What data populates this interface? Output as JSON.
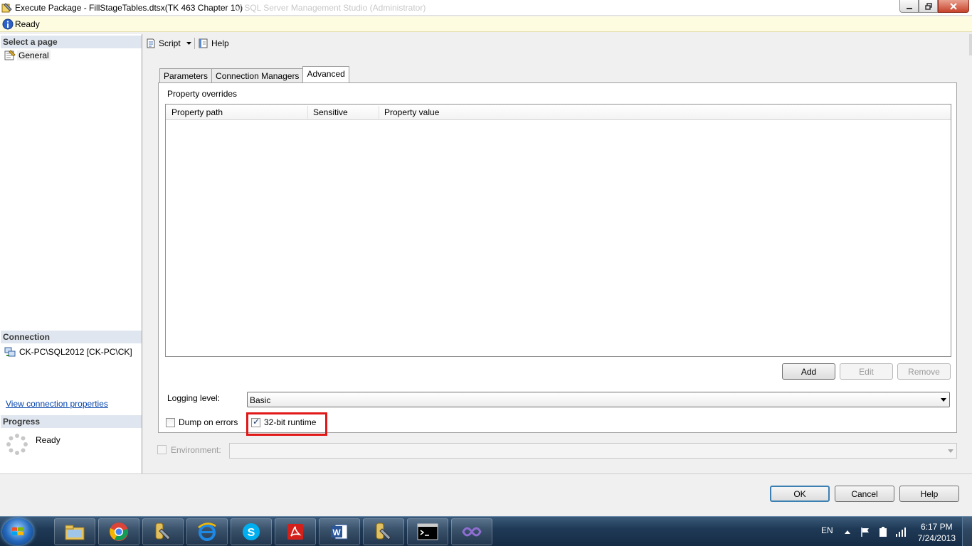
{
  "window": {
    "title": "Execute Package - FillStageTables.dtsx(TK 463 Chapter 10)",
    "title_ghost": "of SQL Server Management Studio (Administrator)"
  },
  "status": {
    "text": "Ready"
  },
  "left": {
    "select_page_header": "Select a page",
    "pages": [
      {
        "label": "General"
      }
    ],
    "connection_header": "Connection",
    "connection_label": "CK-PC\\SQL2012 [CK-PC\\CK]",
    "connection_link": "View connection properties",
    "progress_header": "Progress",
    "progress_text": "Ready"
  },
  "toolbar": {
    "script_label": "Script",
    "help_label": "Help"
  },
  "tabs": [
    {
      "label": "Parameters",
      "active": false
    },
    {
      "label": "Connection Managers",
      "active": false
    },
    {
      "label": "Advanced",
      "active": true
    }
  ],
  "advanced": {
    "property_overrides_label": "Property overrides",
    "columns": [
      "Property path",
      "Sensitive",
      "Property value"
    ],
    "rows": [],
    "add_label": "Add",
    "edit_label": "Edit",
    "remove_label": "Remove",
    "logging_level_label": "Logging level:",
    "logging_level_value": "Basic",
    "dump_on_errors_label": "Dump on errors",
    "dump_on_errors_checked": false,
    "runtime_32bit_label": "32-bit runtime",
    "runtime_32bit_checked": true,
    "environment_label": "Environment:",
    "environment_value": ""
  },
  "footer": {
    "ok_label": "OK",
    "cancel_label": "Cancel",
    "help_label": "Help"
  },
  "taskbar": {
    "apps": [
      "file-explorer-icon",
      "chrome-icon",
      "ssms-icon",
      "internet-explorer-icon",
      "skype-icon",
      "acrobat-icon",
      "word-icon",
      "ssms-icon",
      "cmd-icon",
      "visual-studio-icon"
    ],
    "language": "EN",
    "time": "6:17 PM",
    "date": "7/24/2013"
  },
  "colors": {
    "highlight": "#e01818",
    "link": "#0645ad",
    "section_header": "#dfe6ef"
  }
}
